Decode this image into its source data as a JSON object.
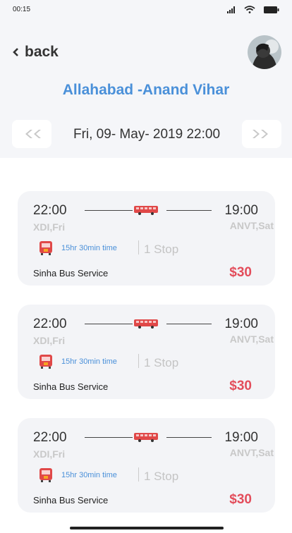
{
  "status_bar": {
    "time": "00:15"
  },
  "header": {
    "back_label": "back",
    "route_title": "Allahabad -Anand Vihar"
  },
  "date_selector": {
    "date_text": "Fri, 09- May- 2019 22:00"
  },
  "colors": {
    "accent": "#4a90d9",
    "price": "#e34d5b",
    "card_bg": "#f3f4f7",
    "page_bg": "#f5f6f9"
  },
  "results": [
    {
      "dep_time": "22:00",
      "dep_code": "XDI,Fri",
      "arr_time": "19:00",
      "arr_code": "ANVT,Sat",
      "duration": "15hr 30min time",
      "stops": "1 Stop",
      "operator": "Sinha Bus Service",
      "price": "$30",
      "icon": "bus-icon"
    },
    {
      "dep_time": "22:00",
      "dep_code": "XDI,Fri",
      "arr_time": "19:00",
      "arr_code": "ANVT,Sat",
      "duration": "15hr 30min time",
      "stops": "1 Stop",
      "operator": "Sinha Bus Service",
      "price": "$30",
      "icon": "bus-icon"
    },
    {
      "dep_time": "22:00",
      "dep_code": "XDI,Fri",
      "arr_time": "19:00",
      "arr_code": "ANVT,Sat",
      "duration": "15hr 30min time",
      "stops": "1 Stop",
      "operator": "Sinha Bus Service",
      "price": "$30",
      "icon": "bus-icon"
    }
  ]
}
